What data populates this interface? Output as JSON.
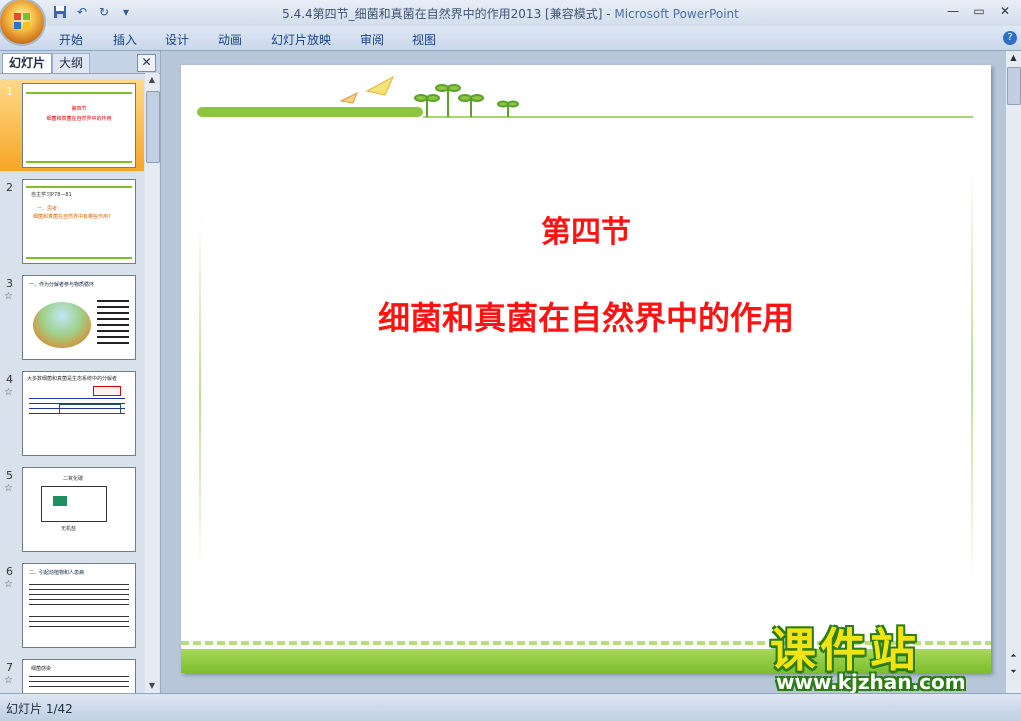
{
  "window": {
    "title_file": "5.4.4第四节_细菌和真菌在自然界中的作用2013 [兼容模式]",
    "title_sep": " - ",
    "title_app": "Microsoft PowerPoint",
    "controls": [
      "—",
      "▭",
      "✕"
    ]
  },
  "ribbon": {
    "tabs": [
      "开始",
      "插入",
      "设计",
      "动画",
      "幻灯片放映",
      "审阅",
      "视图"
    ],
    "help": "?"
  },
  "pane": {
    "tab_slides": "幻灯片",
    "tab_outline": "大纲",
    "close": "✕"
  },
  "thumbnails": [
    {
      "num": "1",
      "selected": true,
      "lines": [
        "第四节",
        "细菌和真菌在自然界中的作用"
      ]
    },
    {
      "num": "2",
      "star": "",
      "lines": [
        "自主学习P78—81",
        "一、思考：",
        "细菌和真菌在自然界中有哪些作用？"
      ]
    },
    {
      "num": "3",
      "star": "☆",
      "lines": [
        "一、作为分解者参与物质循环"
      ]
    },
    {
      "num": "4",
      "star": "☆",
      "lines": [
        "大多数细菌和真菌是生态系统中的分解者"
      ]
    },
    {
      "num": "5",
      "star": "☆",
      "lines": [
        "二氧化碳",
        "无机盐"
      ]
    },
    {
      "num": "6",
      "star": "☆",
      "lines": [
        "二、引起动植物和人患病"
      ]
    },
    {
      "num": "7",
      "star": "☆",
      "lines": [
        "细菌感染"
      ]
    }
  ],
  "slide": {
    "title": "第四节",
    "subtitle": "细菌和真菌在自然界中的作用",
    "accent": "#ff1212",
    "green": "#7cbf2c"
  },
  "status": {
    "text": "幻灯片 1/42"
  },
  "watermark": {
    "brand": "课件站",
    "url": "www.kjzhan.com"
  }
}
